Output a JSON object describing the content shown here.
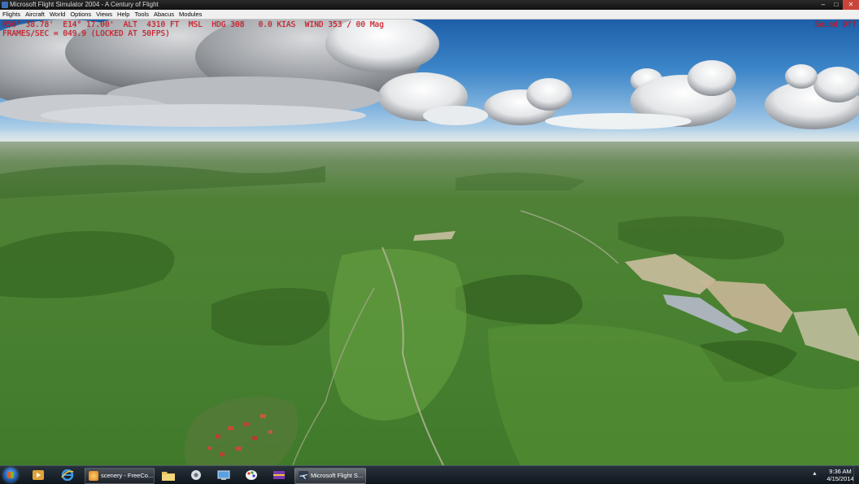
{
  "window": {
    "title": "Microsoft Flight Simulator 2004 - A Century of Flight",
    "minimize_glyph": "–",
    "maximize_glyph": "□",
    "close_glyph": "✕"
  },
  "menu": {
    "items": [
      "Flights",
      "Aircraft",
      "World",
      "Options",
      "Views",
      "Help",
      "Tools",
      "Abacus",
      "Modules"
    ]
  },
  "hud": {
    "line1": "N50° 38.78'  E14° 17.00'  ALT  4310 FT  MSL  HDG 308   0.0 KIAS  WIND 353 / 00 Mag",
    "line2": "FRAMES/SEC = 049.9 (LOCKED AT 50FPS)",
    "sound": "Sound Off",
    "color": "#e0141e"
  },
  "taskbar": {
    "tasks": [
      {
        "label": "scenery - FreeCo...",
        "icon": "browser-icon"
      },
      {
        "label": "Microsoft Flight S...",
        "icon": "airplane-icon"
      }
    ],
    "clock": {
      "time": "9:36 AM",
      "date": "4/15/2014"
    },
    "pinned_icons": [
      "media-player-icon",
      "internet-explorer-icon",
      "folder-icon",
      "tools-icon",
      "network-icon",
      "paint-icon",
      "app-icon"
    ]
  }
}
